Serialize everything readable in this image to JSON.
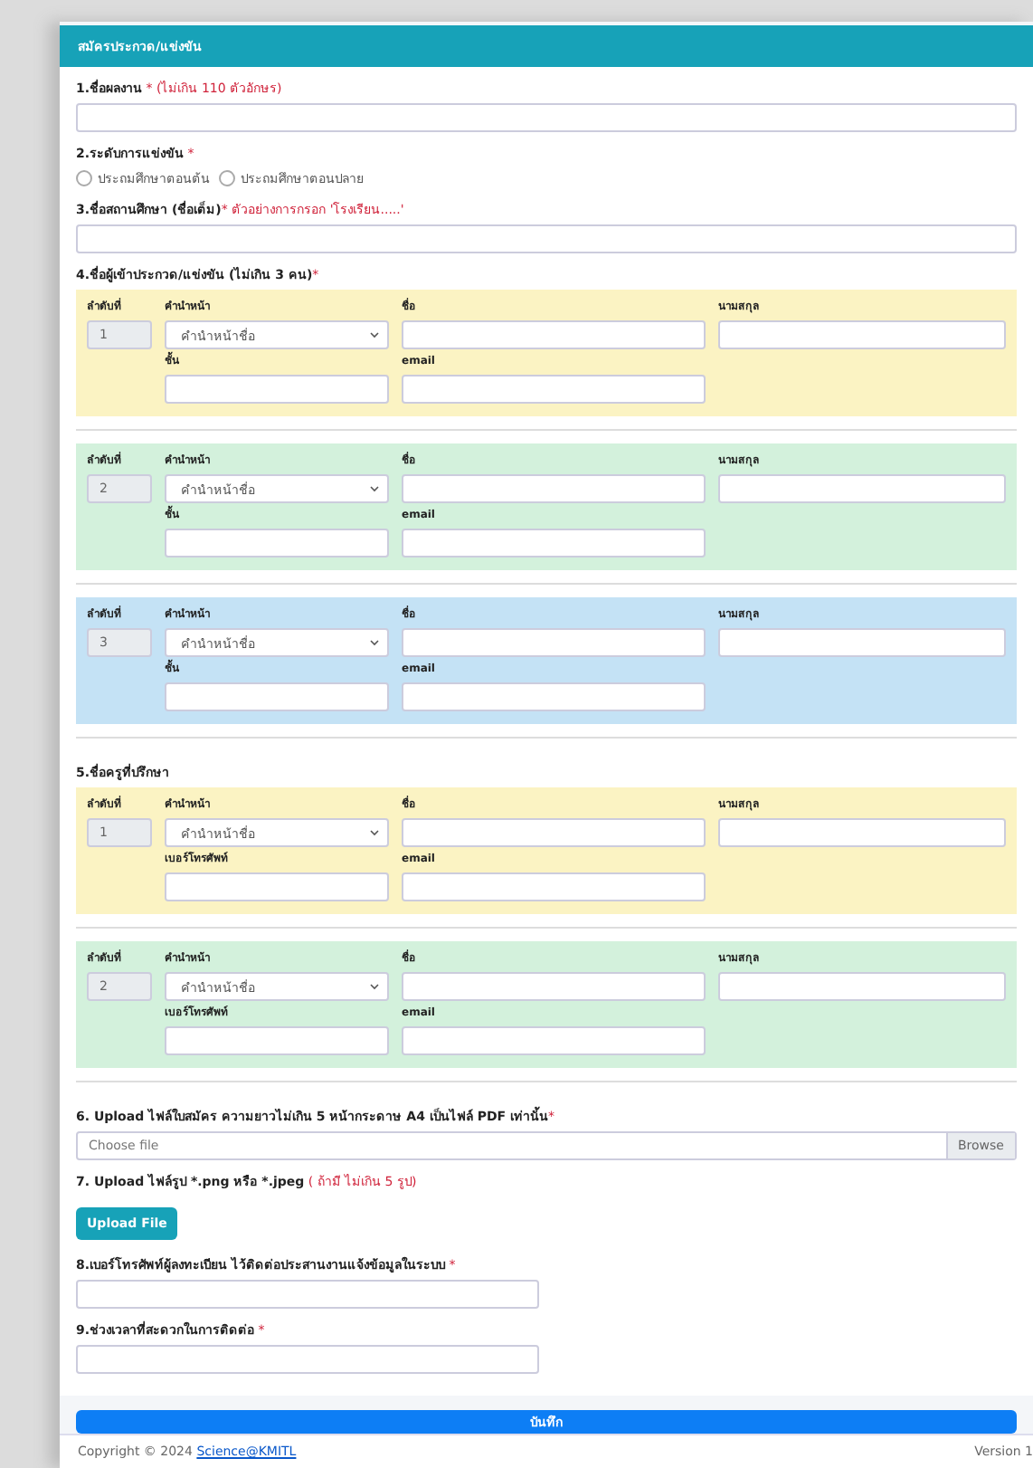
{
  "form": {
    "title": "สมัครประกวด/แข่งขัน"
  },
  "questions": [
    {
      "kind": "text",
      "label": "1.ชื่อผลงาน",
      "note": " * (ไม่เกิน 110 ตัวอักษร)"
    },
    {
      "kind": "radio",
      "label": "2.ระดับการแข่งขัน",
      "note": " *",
      "options": [
        {
          "label": "ประถมศึกษาตอนต้น",
          "selected": false
        },
        {
          "label": "ประถมศึกษาตอนปลาย",
          "selected": false
        }
      ]
    },
    {
      "kind": "text",
      "label": "3.ชื่อสถานศึกษา (ชื่อเต็ม)",
      "note": "* ตัวอย่างการกรอก 'โรงเรียน.....'"
    },
    {
      "kind": "people",
      "label": "4.ชื่อผู้เข้าประกวด/แข่งขัน (ไม่เกิน 3 คน)",
      "note": "*",
      "entries": [
        {
          "color": "#fbf3c3",
          "labels": [
            "ลำดับที่",
            "คำนำหน้า",
            "ชื่อ",
            "นามสกุล",
            "ชั้น",
            "email"
          ],
          "number": "1",
          "prefix": "คำนำหน้าชื่อ"
        },
        {
          "color": "#d3f1dc",
          "labels": [
            "ลำดับที่",
            "คำนำหน้า",
            "ชื่อ",
            "นามสกุล",
            "ชั้น",
            "email"
          ],
          "number": "2",
          "prefix": "คำนำหน้าชื่อ"
        },
        {
          "color": "#c4e2f5",
          "labels": [
            "ลำดับที่",
            "คำนำหน้า",
            "ชื่อ",
            "นามสกุล",
            "ชั้น",
            "email"
          ],
          "number": "3",
          "prefix": "คำนำหน้าชื่อ"
        }
      ]
    },
    {
      "kind": "people",
      "label": "5.ชื่อครูที่ปรึกษา",
      "entries": [
        {
          "color": "#fbf3c3",
          "labels": [
            "ลำดับที่",
            "คำนำหน้า",
            "ชื่อ",
            "นามสกุล",
            "เบอร์โทรศัพท์",
            "email"
          ],
          "number": "1",
          "prefix": "คำนำหน้าชื่อ"
        },
        {
          "color": "#d3f1dc",
          "labels": [
            "ลำดับที่",
            "คำนำหน้า",
            "ชื่อ",
            "นามสกุล",
            "เบอร์โทรศัพท์",
            "email"
          ],
          "number": "2",
          "prefix": "คำนำหน้าชื่อ"
        }
      ]
    },
    {
      "kind": "file",
      "label": "6. Upload ไฟล์ใบสมัคร ความยาวไม่เกิน 5 หน้ากระดาษ A4 เป็นไฟล์ PDF เท่านั้น",
      "note": "*",
      "placeholder": "Choose file",
      "button": "Browse"
    },
    {
      "kind": "upload",
      "label": "7. Upload ไฟล์รูป *.png หรือ *.jpeg",
      "note": " ( ถ้ามี ไม่เกิน 5 รูป)",
      "button": "Upload File"
    },
    {
      "kind": "short-text",
      "label": "8.เบอร์โทรศัพท์ผู้ลงทะเบียน ไว้ติดต่อประสานงานแจ้งข้อมูลในระบบ",
      "note": " *"
    },
    {
      "kind": "short-text",
      "label": "9.ช่วงเวลาที่สะดวกในการติดต่อ",
      "note": " *"
    }
  ],
  "submit": "บันทึก",
  "footer": {
    "copyright": "Copyright © 2024",
    "link": "Science@KMITL",
    "version": "Version 1"
  }
}
